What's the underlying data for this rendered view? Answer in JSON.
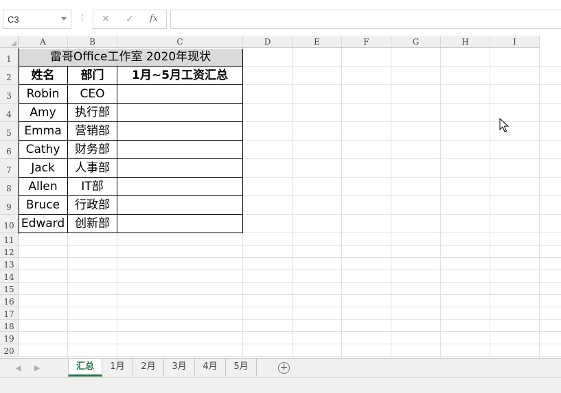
{
  "formula_bar": {
    "name_box": "C3",
    "formula": "",
    "cancel_icon": "✕",
    "enter_icon": "✓",
    "fx_label": "fx"
  },
  "columns": [
    "A",
    "B",
    "C",
    "D",
    "E",
    "F",
    "G",
    "H",
    "I"
  ],
  "rows": [
    "1",
    "2",
    "3",
    "4",
    "5",
    "6",
    "7",
    "8",
    "9",
    "10",
    "11",
    "12",
    "13",
    "14",
    "15",
    "16",
    "17",
    "18",
    "19",
    "20"
  ],
  "table": {
    "title": "雷哥Office工作室 2020年现状",
    "headers": [
      "姓名",
      "部门",
      "1月~5月工资汇总"
    ],
    "rows": [
      [
        "Robin",
        "CEO",
        ""
      ],
      [
        "Amy",
        "执行部",
        ""
      ],
      [
        "Emma",
        "营销部",
        ""
      ],
      [
        "Cathy",
        "财务部",
        ""
      ],
      [
        "Jack",
        "人事部",
        ""
      ],
      [
        "Allen",
        "IT部",
        ""
      ],
      [
        "Bruce",
        "行政部",
        ""
      ],
      [
        "Edward",
        "创新部",
        ""
      ]
    ]
  },
  "sheet_tabs": [
    "汇总",
    "1月",
    "2月",
    "3月",
    "4月",
    "5月"
  ],
  "active_tab": "汇总",
  "colors": {
    "accent": "#217346",
    "title_fill": "#d9d9d9",
    "gridline": "#e0e0e0"
  }
}
